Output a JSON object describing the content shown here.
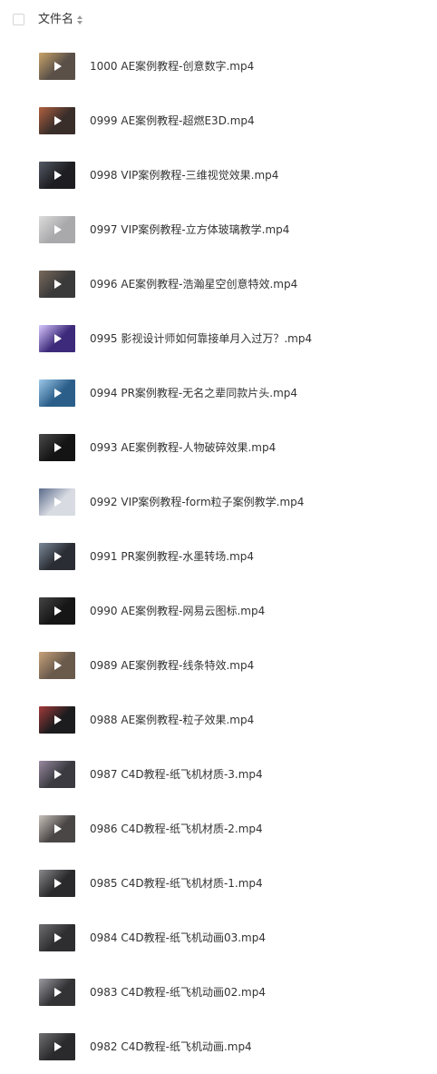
{
  "header": {
    "column_label": "文件名"
  },
  "files": [
    {
      "name": "1000 AE案例教程-创意数字.mp4",
      "thumb_bg": "#5a5048",
      "thumb_fg": "#c9a46a"
    },
    {
      "name": "0999 AE案例教程-超燃E3D.mp4",
      "thumb_bg": "#3a2e2a",
      "thumb_fg": "#b06040"
    },
    {
      "name": "0998 VIP案例教程-三维视觉效果.mp4",
      "thumb_bg": "#1e1e22",
      "thumb_fg": "#555a66"
    },
    {
      "name": "0997 VIP案例教程-立方体玻璃教学.mp4",
      "thumb_bg": "#a9a9ab",
      "thumb_fg": "#dcdcdc"
    },
    {
      "name": "0996 AE案例教程-浩瀚星空创意特效.mp4",
      "thumb_bg": "#3a3a3a",
      "thumb_fg": "#7a6a5c"
    },
    {
      "name": "0995 影视设计师如何靠接单月入过万？.mp4",
      "thumb_bg": "#3d2a7a",
      "thumb_fg": "#d8c8ff"
    },
    {
      "name": "0994 PR案例教程-无名之辈同款片头.mp4",
      "thumb_bg": "#2b5f8a",
      "thumb_fg": "#9cc8e8"
    },
    {
      "name": "0993 AE案例教程-人物破碎效果.mp4",
      "thumb_bg": "#141414",
      "thumb_fg": "#4a4a4a"
    },
    {
      "name": "0992 VIP案例教程-form粒子案例教学.mp4",
      "thumb_bg": "#d8dbe2",
      "thumb_fg": "#5a6a8a"
    },
    {
      "name": "0991 PR案例教程-水墨转场.mp4",
      "thumb_bg": "#2a2d33",
      "thumb_fg": "#7c8a99"
    },
    {
      "name": "0990 AE案例教程-网易云图标.mp4",
      "thumb_bg": "#161616",
      "thumb_fg": "#444444"
    },
    {
      "name": "0989 AE案例教程-线条特效.mp4",
      "thumb_bg": "#6a5a4c",
      "thumb_fg": "#c8a27a"
    },
    {
      "name": "0988 AE案例教程-粒子效果.mp4",
      "thumb_bg": "#1c1c1e",
      "thumb_fg": "#a33a3a"
    },
    {
      "name": "0987 C4D教程-纸飞机材质-3.mp4",
      "thumb_bg": "#3a3a40",
      "thumb_fg": "#9a8aa0"
    },
    {
      "name": "0986 C4D教程-纸飞机材质-2.mp4",
      "thumb_bg": "#4a4646",
      "thumb_fg": "#c9c2bc"
    },
    {
      "name": "0985 C4D教程-纸飞机材质-1.mp4",
      "thumb_bg": "#2a2a2c",
      "thumb_fg": "#8a8a8e"
    },
    {
      "name": "0984 C4D教程-纸飞机动画03.mp4",
      "thumb_bg": "#2e2e30",
      "thumb_fg": "#6e6e72"
    },
    {
      "name": "0983 C4D教程-纸飞机动画02.mp4",
      "thumb_bg": "#333336",
      "thumb_fg": "#9a9aa0"
    },
    {
      "name": "0982 C4D教程-纸飞机动画.mp4",
      "thumb_bg": "#2a2a2c",
      "thumb_fg": "#707074"
    }
  ]
}
